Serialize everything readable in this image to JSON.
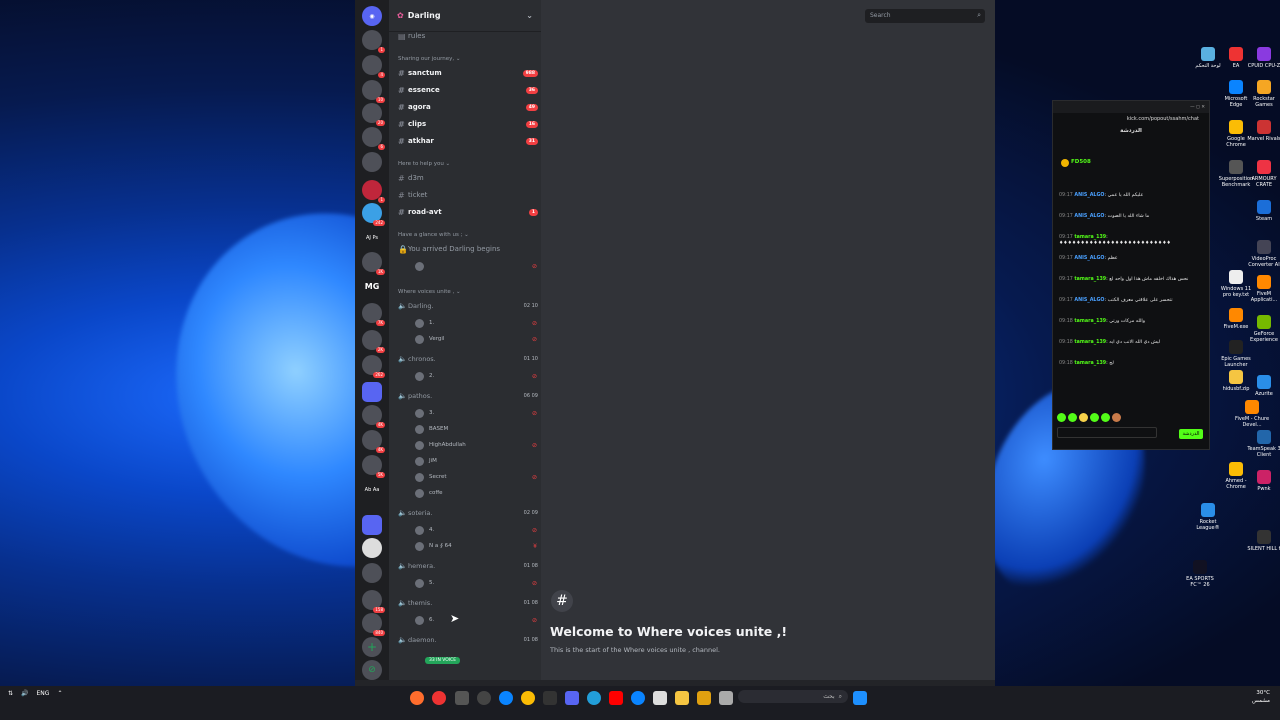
{
  "discord": {
    "server_name": "Darling",
    "search_placeholder": "Search",
    "channels": {
      "rules": "rules",
      "cat_journey": "Sharing our journey, ⌄",
      "journey": [
        {
          "name": "sanctum",
          "count": "988"
        },
        {
          "name": "essence",
          "count": "36"
        },
        {
          "name": "agora",
          "count": "49"
        },
        {
          "name": "clips",
          "count": "16"
        },
        {
          "name": "atkhar",
          "count": "31"
        }
      ],
      "cat_help": "Here to help you ⌄",
      "help": [
        {
          "name": "d3m",
          "count": ""
        },
        {
          "name": "ticket",
          "count": ""
        },
        {
          "name": "road-avt",
          "count": "1"
        }
      ],
      "cat_glance": "Have a glance with us ; ⌄",
      "glance_item": "You arrived Darling begins",
      "cat_voices": "Where voices unite , ⌄"
    },
    "voice_channels": [
      {
        "name": "Darling.",
        "limit": "02 10"
      },
      {
        "name": "chronos.",
        "limit": "01 10"
      },
      {
        "name": "pathos.",
        "limit": "06 09"
      },
      {
        "name": "soteria.",
        "limit": "02 09"
      },
      {
        "name": "hemera.",
        "limit": "01 08"
      },
      {
        "name": "themis.",
        "limit": "01 08"
      },
      {
        "name": "daemon.",
        "limit": "01 08"
      }
    ],
    "voice_users": [
      {
        "name": "1."
      },
      {
        "name": "Vergil"
      },
      {
        "name": "2."
      },
      {
        "name": "3."
      },
      {
        "name": "BASEM"
      },
      {
        "name": "HighAbdullah"
      },
      {
        "name": "JiM"
      },
      {
        "name": "Secret"
      },
      {
        "name": "coffe"
      },
      {
        "name": "4."
      },
      {
        "name": "N a ∮ 64"
      },
      {
        "name": "5."
      },
      {
        "name": "6."
      }
    ],
    "in_voice": "33 IN VOICE",
    "welcome_title": "Welcome to Where voices unite ,!",
    "welcome_sub": "This is the start of the Where voices unite , channel."
  },
  "kick": {
    "url": "kick.com/popout/ssahm/chat",
    "header": "الدردشة",
    "top_user": "FD508",
    "messages": [
      {
        "time": "09:17",
        "user": "ANIS_ALGO",
        "text": "عليكم الله يا عمي"
      },
      {
        "time": "09:17",
        "user": "ANIS_ALGO",
        "text": "ما شاء الله يا الصوت"
      },
      {
        "time": "09:17",
        "user": "tamara_139",
        "text": "♦♦♦♦♦♦♦♦♦♦♦♦♦♦♦♦♦♦♦♦♦♦♦♦♦♦"
      },
      {
        "time": "09:17",
        "user": "ANIS_ALGO",
        "text": "عظم"
      },
      {
        "time": "09:17",
        "user": "tamara_139",
        "text": "نحس هذاك اخلقه ماش هذا اول واحد لع"
      },
      {
        "time": "09:17",
        "user": "ANIS_ALGO",
        "text": "تتحسر على علاقتي معرف الكتب"
      },
      {
        "time": "09:18",
        "user": "tamara_139",
        "text": "والله مركات ورتي"
      },
      {
        "time": "09:18",
        "user": "tamara_139",
        "text": "ليش دي الله الانب دي ايه"
      },
      {
        "time": "09:18",
        "user": "tamara_139",
        "text": "لح"
      }
    ],
    "send_label": "الدردشة"
  },
  "taskbar": {
    "lang": "ENG",
    "search_label": "بحث",
    "clock_time": "30°C",
    "clock_date": "مشمس"
  },
  "desktop_icons": [
    "لوحة التحكم",
    "EA",
    "CPUID CPU-Z",
    "Microsoft Edge",
    "Rockstar Games",
    "Google Chrome",
    "Marvel Rivals",
    "Superposition Benchmark",
    "ARMOURY CRATE",
    "Steam",
    "VideoProc Converter AI",
    "Windows 11 pro key.txt",
    "FiveM Applicati...",
    "FiveM.exe",
    "GeForce Experience",
    "Epic Games Launcher",
    "hidusbf.zip",
    "Azurite",
    "FiveM - Chure Devel...",
    "TeamSpeak 3 Client",
    "Ahmed - Chrome",
    "Pwnk",
    "Rocket League®",
    "SILENT HILL f",
    "EA SPORTS FC™ 26"
  ],
  "colors": {
    "discord_bg": "#313338",
    "sidebar": "#2b2d31",
    "guilds": "#1e1f22",
    "badge": "#f23f42",
    "voice_green": "#23a55a",
    "kick_green": "#53fc18"
  }
}
